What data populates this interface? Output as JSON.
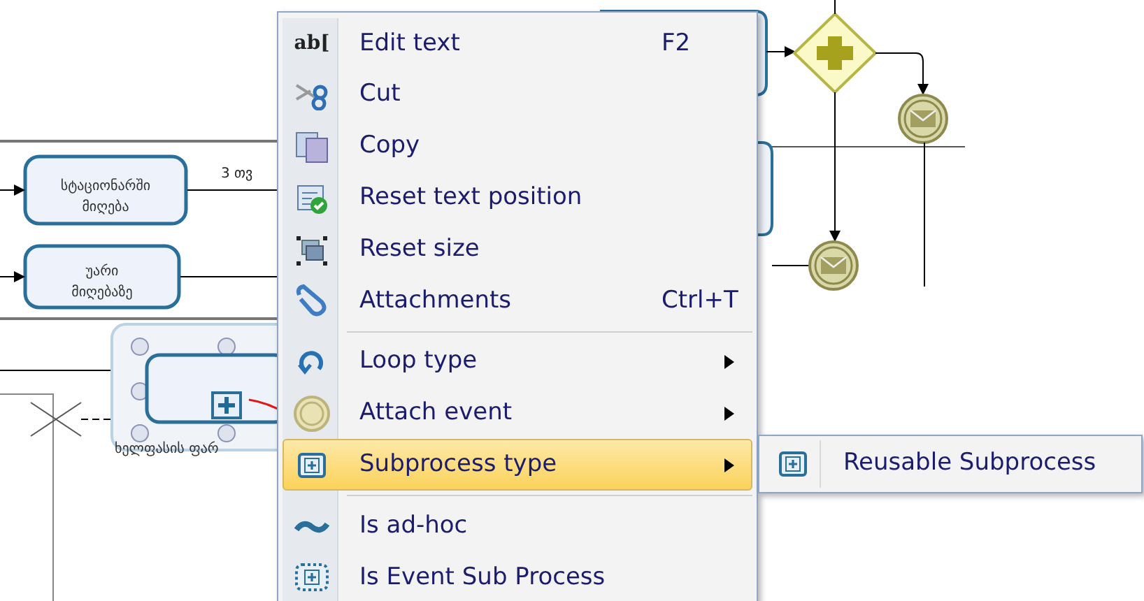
{
  "diagram": {
    "tasks": [
      {
        "label": "სტაციონარში",
        "label_2": "მიღება"
      },
      {
        "label": "უარი",
        "label_2": "მიღებაზე"
      }
    ],
    "flow_label": "3 თვ",
    "subprocess": {
      "label": "ხელფასის ფარ",
      "selected": true
    }
  },
  "context_menu": {
    "items": [
      {
        "kind": "item",
        "icon_text": "ab[",
        "label": "Edit text",
        "shortcut": "F2",
        "submenu": false,
        "selected": false
      },
      {
        "kind": "item",
        "label": "Cut",
        "submenu": false,
        "selected": false
      },
      {
        "kind": "item",
        "label": "Copy",
        "submenu": false,
        "selected": false
      },
      {
        "kind": "item",
        "label": "Reset text position",
        "submenu": false,
        "selected": false
      },
      {
        "kind": "item",
        "label": "Reset size",
        "submenu": false,
        "selected": false
      },
      {
        "kind": "item",
        "label": "Attachments",
        "shortcut": "Ctrl+T",
        "submenu": false,
        "selected": false
      },
      {
        "kind": "separator"
      },
      {
        "kind": "item",
        "label": "Loop type",
        "submenu": true,
        "selected": false
      },
      {
        "kind": "item",
        "label": "Attach event",
        "submenu": true,
        "selected": false
      },
      {
        "kind": "item",
        "label": "Subprocess type",
        "submenu": true,
        "selected": true
      },
      {
        "kind": "separator"
      },
      {
        "kind": "item",
        "label": "Is ad-hoc",
        "submenu": false,
        "selected": false
      },
      {
        "kind": "item",
        "label": "Is Event Sub Process",
        "submenu": false,
        "selected": false
      }
    ]
  },
  "submenu": {
    "items": [
      {
        "label": "Reusable Subprocess"
      }
    ]
  }
}
